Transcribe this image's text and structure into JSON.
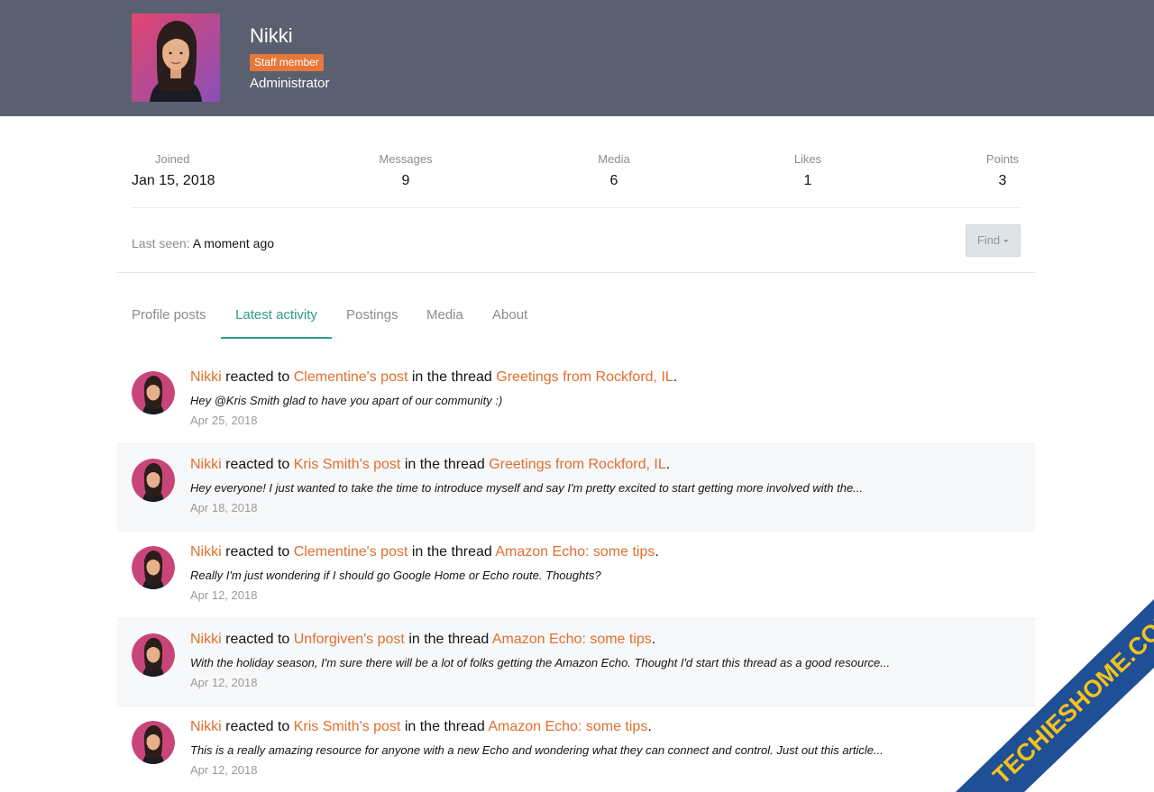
{
  "profile": {
    "name": "Nikki",
    "badge": "Staff member",
    "title": "Administrator"
  },
  "stats": [
    {
      "label": "Joined",
      "value": "Jan 15, 2018"
    },
    {
      "label": "Messages",
      "value": "9"
    },
    {
      "label": "Media",
      "value": "6"
    },
    {
      "label": "Likes",
      "value": "1"
    },
    {
      "label": "Points",
      "value": "3"
    }
  ],
  "last_seen": {
    "label": "Last seen:",
    "value": "A moment ago"
  },
  "find_button": {
    "label": "Find"
  },
  "tabs": [
    {
      "label": "Profile posts"
    },
    {
      "label": "Latest activity"
    },
    {
      "label": "Postings"
    },
    {
      "label": "Media"
    },
    {
      "label": "About"
    }
  ],
  "activity": [
    {
      "user": "Nikki",
      "verb": "reacted to",
      "post": "Clementine's post",
      "mid": "in the thread",
      "thread": "Greetings from Rockford, IL",
      "end": ".",
      "snippet": "Hey @Kris Smith glad to have you apart of our community :)",
      "date": "Apr 25, 2018"
    },
    {
      "user": "Nikki",
      "verb": "reacted to",
      "post": "Kris Smith's post",
      "mid": "in the thread",
      "thread": "Greetings from Rockford, IL",
      "end": ".",
      "snippet": "Hey everyone! I just wanted to take the time to introduce myself and say I'm pretty excited to start getting more involved with the...",
      "date": "Apr 18, 2018"
    },
    {
      "user": "Nikki",
      "verb": "reacted to",
      "post": "Clementine's post",
      "mid": "in the thread",
      "thread": "Amazon Echo: some tips",
      "end": ".",
      "snippet": "Really I'm just wondering if I should go Google Home or Echo route. Thoughts?",
      "date": "Apr 12, 2018"
    },
    {
      "user": "Nikki",
      "verb": "reacted to",
      "post": "Unforgiven's post",
      "mid": "in the thread",
      "thread": "Amazon Echo: some tips",
      "end": ".",
      "snippet": "With the holiday season, I'm sure there will be a lot of folks getting the Amazon Echo. Thought I'd start this thread as a good resource...",
      "date": "Apr 12, 2018"
    },
    {
      "user": "Nikki",
      "verb": "reacted to",
      "post": "Kris Smith's post",
      "mid": "in the thread",
      "thread": "Amazon Echo: some tips",
      "end": ".",
      "snippet": "This is a really amazing resource for anyone with a new Echo and wondering what they can connect and control. Just out this article...",
      "date": "Apr 12, 2018"
    }
  ],
  "watermark": {
    "text": "TECHIESHOME.COM"
  },
  "colors": {
    "banner": "#5a6070",
    "accent_link": "#e06f2e",
    "tab_active": "#2f9e86",
    "badge": "#e8773a"
  }
}
